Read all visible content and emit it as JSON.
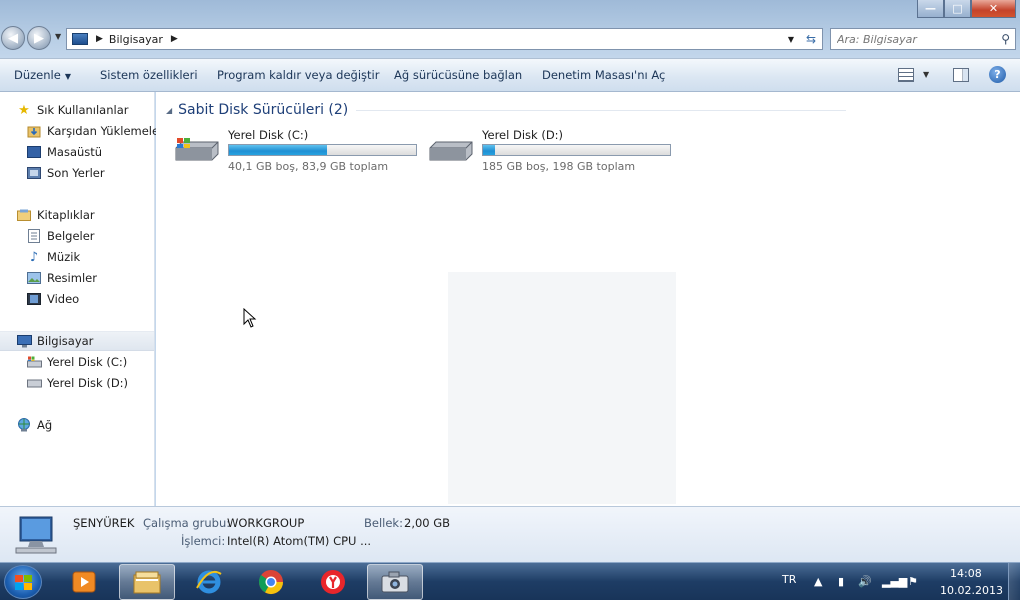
{
  "window": {
    "controls": {
      "minimize": "—",
      "maximize": "□",
      "close": "✕"
    }
  },
  "address": {
    "breadcrumb": [
      "Bilgisayar"
    ],
    "search_placeholder": "Ara: Bilgisayar"
  },
  "toolbar": {
    "organize": "Düzenle",
    "system_properties": "Sistem özellikleri",
    "uninstall": "Program kaldır veya değiştir",
    "map_drive": "Ağ sürücüsüne bağlan",
    "control_panel": "Denetim Masası'nı Aç"
  },
  "nav": {
    "favorites": {
      "label": "Sık Kullanılanlar",
      "items": [
        "Karşıdan Yüklemeler",
        "Masaüstü",
        "Son Yerler"
      ]
    },
    "libraries": {
      "label": "Kitaplıklar",
      "items": [
        "Belgeler",
        "Müzik",
        "Resimler",
        "Video"
      ]
    },
    "computer": {
      "label": "Bilgisayar",
      "items": [
        "Yerel Disk (C:)",
        "Yerel Disk (D:)"
      ]
    },
    "network": {
      "label": "Ağ"
    }
  },
  "content": {
    "group_title": "Sabit Disk Sürücüleri (2)",
    "drives": [
      {
        "name": "Yerel Disk (C:)",
        "info": "40,1 GB boş, 83,9 GB toplam",
        "used_fraction": 0.522
      },
      {
        "name": "Yerel Disk (D:)",
        "info": "185 GB boş, 198 GB toplam",
        "used_fraction": 0.066
      }
    ]
  },
  "details": {
    "computer_name": "ŞENYÜREK",
    "workgroup_label": "Çalışma grubu:",
    "workgroup_value": "WORKGROUP",
    "memory_label": "Bellek:",
    "memory_value": "2,00 GB",
    "processor_label": "İşlemci:",
    "processor_value": "Intel(R) Atom(TM) CPU ..."
  },
  "taskbar": {
    "language": "TR",
    "time": "14:08",
    "date": "10.02.2013"
  },
  "colors": {
    "drive_bar_fill": "#26a2e0",
    "nav_selected": "#dfe6ef"
  }
}
